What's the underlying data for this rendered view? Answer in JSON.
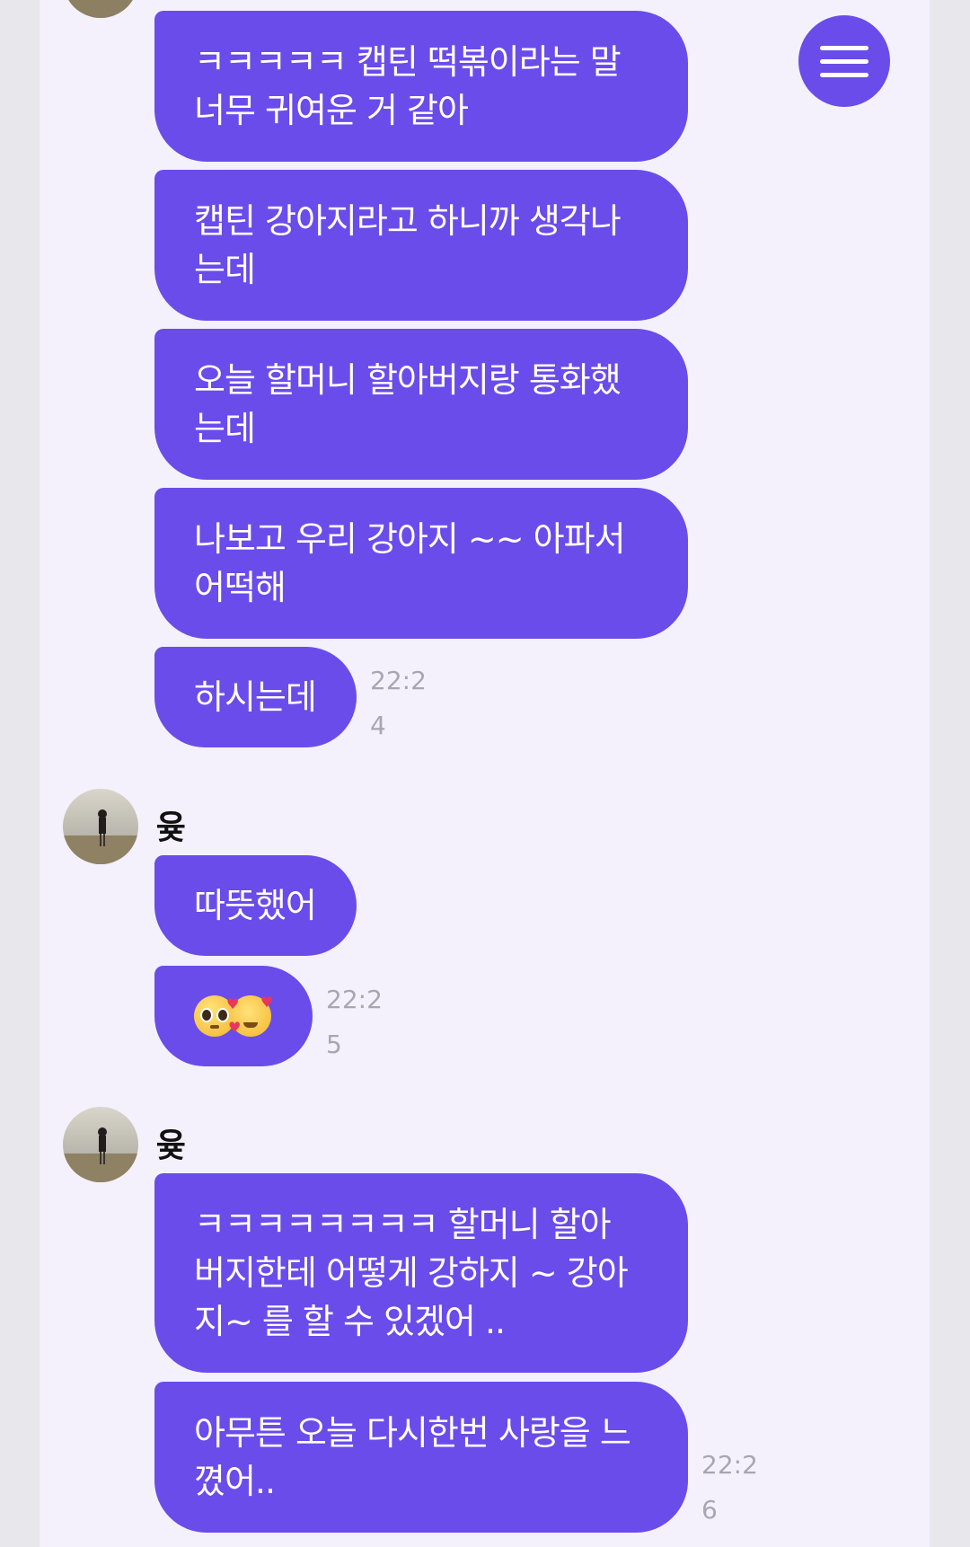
{
  "conversation": {
    "sender_name": "윶",
    "menu_label": "menu",
    "messages_top": [
      "ㅋㅋㅋㅋㅋ 캡틴 떡볶이라는 말\n너무 귀여운 거 같아",
      "캡틴 강아지라고 하니까 생각나\n는데",
      "오늘 할머니 할아버지랑 통화했\n는데",
      "나보고 우리 강아지 ~~ 아파서\n어떡해",
      "하시는데"
    ],
    "time_1": "22:2\n4",
    "messages_mid": [
      "따뜻했어"
    ],
    "emoji_message": [
      "pleading-face",
      "smiling-face-with-hearts"
    ],
    "time_2": "22:2\n5",
    "messages_bottom": [
      "ㅋㅋㅋㅋㅋㅋㅋㅋ 할머니 할아\n버지한테 어떻게 강하지 ~ 강아\n지~ 를 할 수 있겠어 ..",
      "아무튼 오늘 다시한번 사랑을 느\n꼈어.."
    ],
    "time_3": "22:2\n6"
  },
  "colors": {
    "bubble": "#6a4cea",
    "panel_background": "#f4f1fc",
    "outer_background": "#e8e7eb",
    "timestamp": "#a9a6b2"
  },
  "icons": {
    "menu": "hamburger-menu-icon",
    "avatar": "profile-photo-beach"
  }
}
